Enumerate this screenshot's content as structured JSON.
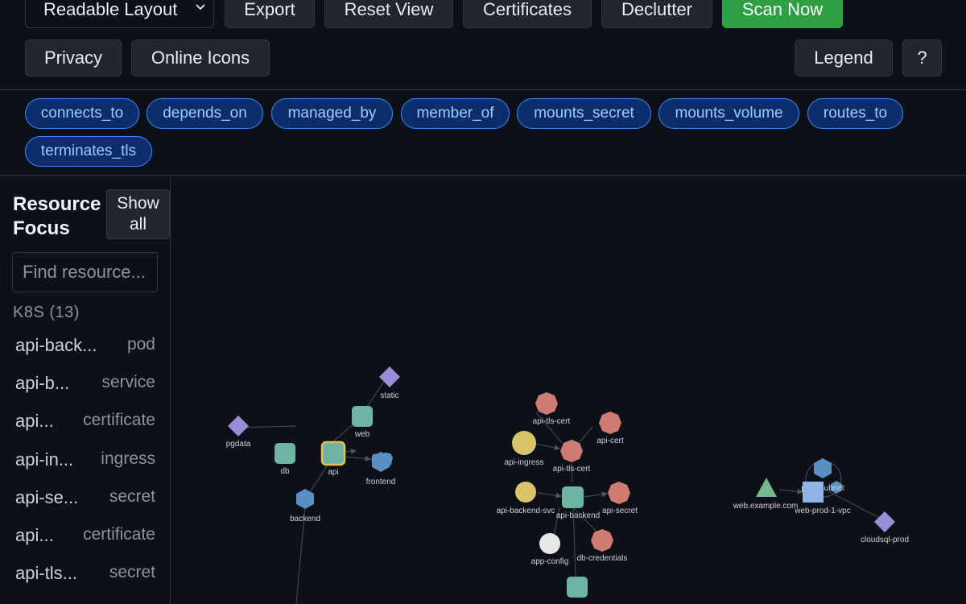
{
  "toolbar": {
    "layout_select": "Readable Layout",
    "export": "Export",
    "reset_view": "Reset View",
    "certificates": "Certificates",
    "declutter": "Declutter",
    "scan_now": "Scan Now",
    "privacy": "Privacy",
    "online_icons": "Online Icons",
    "legend": "Legend",
    "help": "?"
  },
  "relations": [
    "connects_to",
    "depends_on",
    "managed_by",
    "member_of",
    "mounts_secret",
    "mounts_volume",
    "routes_to",
    "terminates_tls"
  ],
  "sidebar": {
    "title_line1": "Resource",
    "title_line2": "Focus",
    "show_all_line1": "Show",
    "show_all_line2": "all",
    "search_placeholder": "Find resource...",
    "group_title": "K8S (13)",
    "items": [
      {
        "name": "api-back...",
        "type": "pod"
      },
      {
        "name": "api-b...",
        "type": "service"
      },
      {
        "name": "api...",
        "type": "certificate"
      },
      {
        "name": "api-in...",
        "type": "ingress"
      },
      {
        "name": "api-se...",
        "type": "secret"
      },
      {
        "name": "api...",
        "type": "certificate"
      },
      {
        "name": "api-tls...",
        "type": "secret"
      }
    ]
  },
  "graph": {
    "colors": {
      "service": "#5b8fc4",
      "pod": "#6fb3a2",
      "volume": "#9a8ed6",
      "secret": "#cf7b72",
      "ingress": "#d9c46a",
      "config": "#e8e8e8",
      "vpc": "#8fb4e8",
      "domain": "#75b88c"
    },
    "labels": {
      "static": "static",
      "web": "web",
      "pgdata": "pgdata",
      "db": "db",
      "api": "api",
      "frontend": "frontend",
      "backend": "backend",
      "api_tls_cert_top": "api-tls-cert",
      "api_cert": "api-cert",
      "api_ingress": "api-ingress",
      "api_tls_cert": "api-tls-cert",
      "api_backend_svc": "api-backend-svc",
      "api_backend": "api-backend",
      "api_secret": "api-secret",
      "app_config": "app-config",
      "db_credentials": "db-credentials",
      "web_example": "web.example.com",
      "subnet": "prod-subnet",
      "web_prod_vpc": "web-prod-1-vpc",
      "cloudsql_prod": "cloudsql-prod"
    }
  }
}
